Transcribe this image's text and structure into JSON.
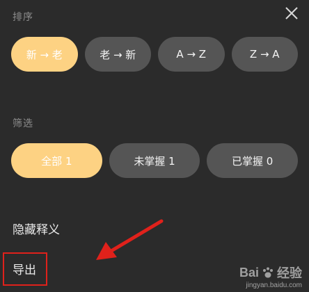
{
  "sort": {
    "title": "排序",
    "options": [
      {
        "label": "新 → 老",
        "active": true
      },
      {
        "label": "老 → 新",
        "active": false
      },
      {
        "label": "A → Z",
        "active": false
      },
      {
        "label": "Z → A",
        "active": false
      }
    ]
  },
  "filter": {
    "title": "筛选",
    "options": [
      {
        "label": "全部 1",
        "active": true
      },
      {
        "label": "未掌握 1",
        "active": false
      },
      {
        "label": "已掌握 0",
        "active": false
      }
    ]
  },
  "options": {
    "hide_definition": "隐藏释义",
    "export": "导出"
  },
  "watermark": {
    "brand_left": "Bai",
    "brand_right": "经验",
    "url": "jingyan.baidu.com"
  },
  "colors": {
    "active_chip": "#fdd283",
    "inactive_chip": "#555555",
    "highlight": "#e0211b"
  },
  "icons": {
    "close": "close-icon",
    "annotation_arrow": "arrow-icon",
    "watermark_paw": "paw-icon"
  }
}
